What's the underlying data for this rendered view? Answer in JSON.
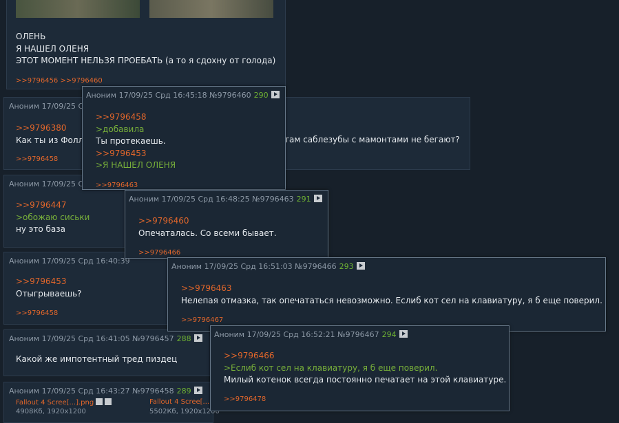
{
  "op_tail": {
    "lines": [
      "ОЛЕНЬ",
      "Я НАШЕЛ ОЛЕНЯ",
      "ЭТОТ МОМЕНТ НЕЛЬЗЯ ПРОЕБАТЬ (а то я сдохну от голода)"
    ],
    "replies": ">>9796456 >>9796460"
  },
  "post_380": {
    "head": "Аноним 17/09/25 Срд 16:",
    "ref": ">>9796380",
    "text_left": "Как ты из Фолл",
    "text_right": "там саблезубы с мамонтами не бегают?",
    "replies": ">>9796458"
  },
  "post_447": {
    "head": "Аноним 17/09/25 Срд 1",
    "ref": ">>9796447",
    "quote": ">обожаю сиськи",
    "text": "ну это база"
  },
  "post_453": {
    "head": "Аноним 17/09/25 Срд 16:40:39",
    "ref": ">>9796453",
    "text": "Отыгрываешь?",
    "replies": ">>9796458"
  },
  "post_457": {
    "head": "Аноним 17/09/25 Срд 16:41:05 №9796457",
    "num": "288",
    "text": "Какой же импотентный тред пиздец"
  },
  "post_458": {
    "head": "Аноним 17/09/25 Срд 16:43:27 №9796458",
    "num": "289",
    "img1_name": "Fallout 4 Scree[...].png",
    "img1_meta": "4908Кб, 1920x1200",
    "img2_name": "Fallout 4 Scree[...",
    "img2_meta": "5502Кб, 1920x1200"
  },
  "popup_460": {
    "head": "Аноним 17/09/25 Срд 16:45:18 №9796460",
    "num": "290",
    "ref1": ">>9796458",
    "quote1": ">добавила",
    "text1": "Ты протекаешь.",
    "ref2": ">>9796453",
    "quote2": ">Я НАШЕЛ ОЛЕНЯ",
    "replies": ">>9796463"
  },
  "popup_463": {
    "head": "Аноним 17/09/25 Срд 16:48:25 №9796463",
    "num": "291",
    "ref": ">>9796460",
    "text": "Опечаталась. Со всеми бывает.",
    "replies": ">>9796466"
  },
  "popup_466": {
    "head": "Аноним 17/09/25 Срд 16:51:03 №9796466",
    "num": "293",
    "ref": ">>9796463",
    "text": "Нелепая отмазка, так опечататься невозможно. Еслиб кот сел на клавиатуру, я б еще поверил.",
    "replies": ">>9796467"
  },
  "popup_467": {
    "head": "Аноним 17/09/25 Срд 16:52:21 №9796467",
    "num": "294",
    "ref": ">>9796466",
    "quote": ">Еслиб кот сел на клавиатуру, я б еще поверил.",
    "text": "Милый котенок всегда постоянно печатает на этой клавиатуре.",
    "replies": ">>9796478"
  }
}
